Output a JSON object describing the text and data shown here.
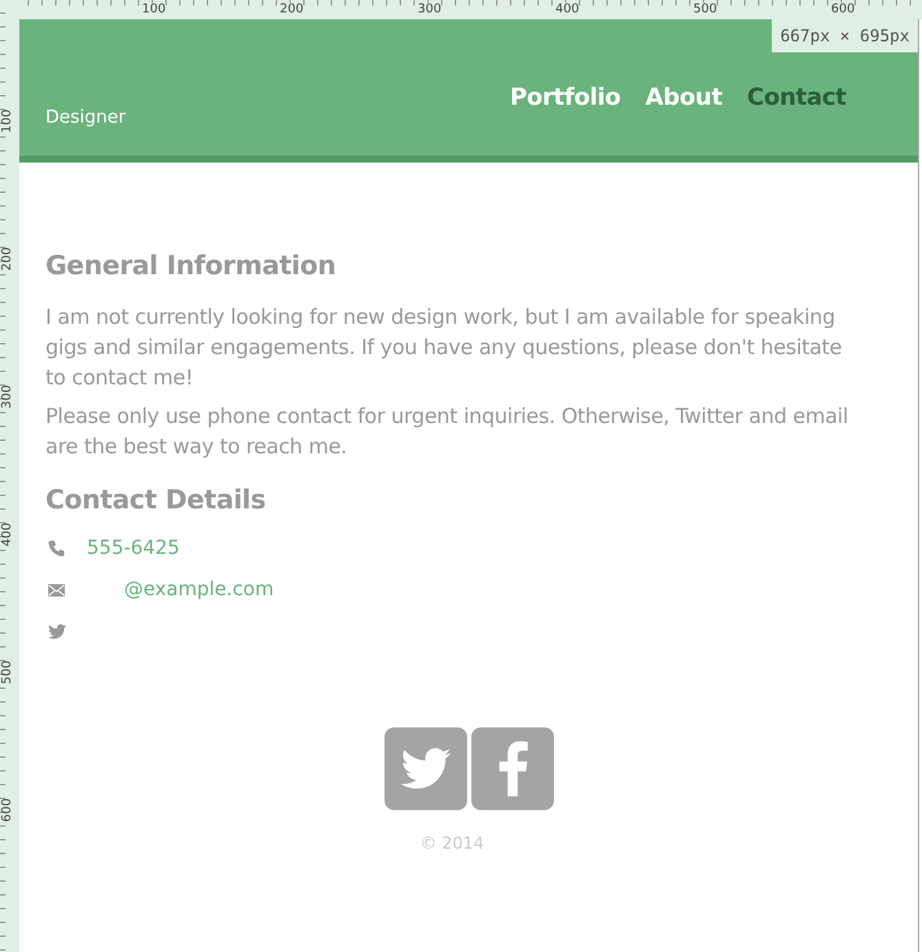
{
  "rulers": {
    "top_labels": [
      "100",
      "200",
      "300",
      "400",
      "500",
      "600"
    ],
    "left_labels": [
      "100",
      "200",
      "300",
      "400",
      "500",
      "600"
    ]
  },
  "size_badge": "667px × 695px",
  "header": {
    "tagline": "Designer",
    "nav": [
      {
        "label": "Portfolio",
        "selected": false
      },
      {
        "label": "About",
        "selected": false
      },
      {
        "label": "Contact",
        "selected": true
      }
    ]
  },
  "general": {
    "heading": "General Information",
    "paragraphs": [
      "I am not currently looking for new design work, but I am available for speaking gigs and similar engagements. If you have any questions, please don't hesitate to contact me!",
      "Please only use phone contact for urgent inquiries. Otherwise, Twitter and email are the best way to reach me."
    ]
  },
  "contact": {
    "heading": "Contact Details",
    "items": [
      {
        "kind": "phone",
        "text": "555-6425"
      },
      {
        "kind": "email",
        "text": "@example.com"
      },
      {
        "kind": "twitter"
      }
    ]
  },
  "social": [
    {
      "kind": "twitter"
    },
    {
      "kind": "facebook"
    }
  ],
  "copyright": "© 2014"
}
